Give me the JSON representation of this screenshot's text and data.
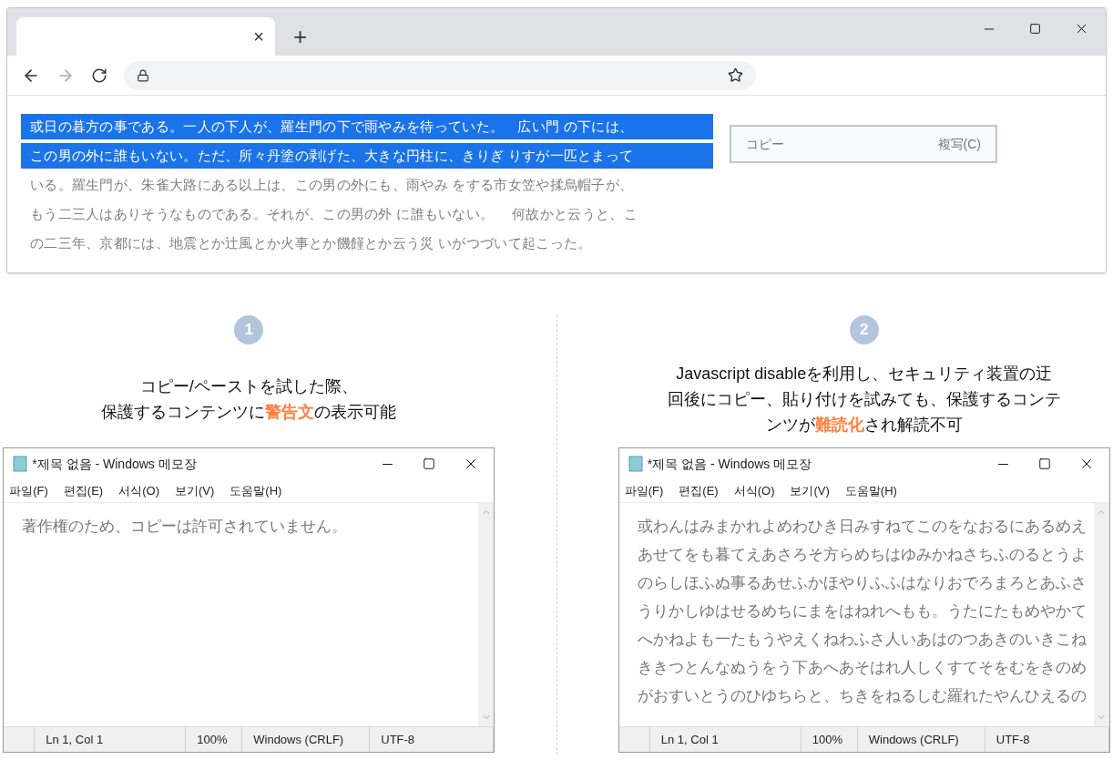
{
  "browser": {
    "tab_close": "×",
    "new_tab": "+",
    "lines": [
      {
        "text": "或日の暮方の事である。一人の下人が、羅生門の下で雨やみを待っていた。　広い門 の下には、",
        "selected": true
      },
      {
        "text": "この男の外に誰もいない。ただ、所々丹塗の剥げた、大きな円柱に、きりぎ りすが一匹とまって",
        "selected": true
      },
      {
        "text": "いる。羅生門が、朱雀大路にある以上は、この男の外にも、雨やみ をする市女笠や揉烏帽子が、",
        "selected": false
      },
      {
        "text": "もう二三人はありそうなものである。それが、この男の外 に誰もいない。　 何故かと云うと、こ",
        "selected": false
      },
      {
        "text": "の二三年、京都には、地震とか辻風とか火事とか饑饉とか云う災 いがつづいて起こった。",
        "selected": false
      }
    ],
    "context_menu": {
      "label": "コピー",
      "shortcut": "複写(C)"
    }
  },
  "steps": [
    {
      "number": "1",
      "caption_lines": [
        "コピー/ペーストを試した際、",
        "保護するコンテンツに**警告文**の表示可能"
      ],
      "notepad": {
        "title": "*제목 없음 - Windows 메모장",
        "menu": [
          "파일(F)",
          "편집(E)",
          "서식(O)",
          "보기(V)",
          "도움말(H)"
        ],
        "lines": [
          "著作権のため、コピーは許可されていません。"
        ],
        "status": [
          "Ln 1, Col 1",
          "100%",
          "Windows (CRLF)",
          "UTF-8"
        ]
      }
    },
    {
      "number": "2",
      "caption_lines": [
        "Javascript disableを利用し、セキュリティ装置の迂",
        "回後にコピー、貼り付けを試みても、保護するコンテ",
        "ンツが**難読化**され解読不可"
      ],
      "notepad": {
        "title": "*제목 없음 - Windows 메모장",
        "menu": [
          "파일(F)",
          "편집(E)",
          "서식(O)",
          "보기(V)",
          "도움말(H)"
        ],
        "lines": [
          "或わんはみまかれよめわひき日みすねてこのをなおるにあるめえ",
          "あせてをも暮てえあさろそ方らめちはゆみかねさちふのるとうよ",
          "のらしほふぬ事るあせふかほやりふふはなりおでろまろとあふさ",
          "うりかしゆはせるめちにまをはねれへもも。うたにたもめやかて",
          "へかねよも一たもうやえくねわふさ人いあはのつあきのいきこね",
          "ききつとんなぬうをう下あへあそはれ人しくすてそをむをきのめ",
          "がおすいとうのひゆちらと、ちきをねるしむ羅れたやんひえるの"
        ],
        "status": [
          "Ln 1, Col 1",
          "100%",
          "Windows (CRLF)",
          "UTF-8"
        ]
      }
    }
  ]
}
